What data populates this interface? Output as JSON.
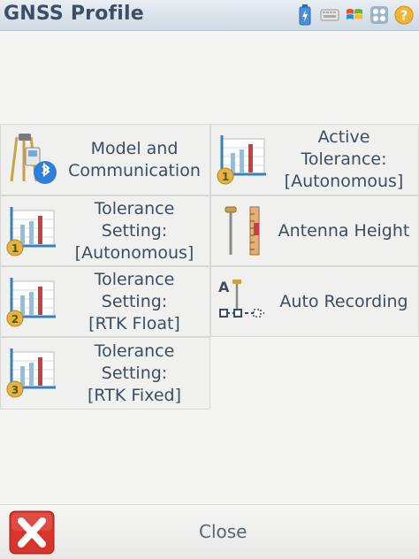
{
  "window": {
    "title": "GNSS Profile"
  },
  "status_icons": [
    {
      "name": "battery-charging-icon"
    },
    {
      "name": "keyboard-icon"
    },
    {
      "name": "windows-start-icon"
    },
    {
      "name": "apps-grid-icon"
    },
    {
      "name": "help-icon"
    }
  ],
  "menu": {
    "model_communication": {
      "label": "Model and\nCommunication",
      "icon": "receiver-bluetooth-icon"
    },
    "active_tolerance": {
      "label": "Active Tolerance:\n[Autonomous]",
      "icon": "tolerance-chart-1-icon"
    },
    "tolerance_autonomous": {
      "label": "Tolerance\nSetting:\n[Autonomous]",
      "icon": "tolerance-chart-1-icon"
    },
    "antenna_height": {
      "label": "Antenna Height",
      "icon": "antenna-ruler-icon"
    },
    "tolerance_rtk_float": {
      "label": "Tolerance\nSetting:\n[RTK Float]",
      "icon": "tolerance-chart-2-icon"
    },
    "auto_recording": {
      "label": "Auto Recording",
      "icon": "auto-record-icon"
    },
    "tolerance_rtk_fixed": {
      "label": "Tolerance\nSetting:\n[RTK Fixed]",
      "icon": "tolerance-chart-3-icon"
    }
  },
  "footer": {
    "close_label": "Close"
  },
  "colors": {
    "title": "#3b4f66",
    "label": "#3d4d5e",
    "close_red": "#d9342b",
    "badge": "#e0b640"
  }
}
